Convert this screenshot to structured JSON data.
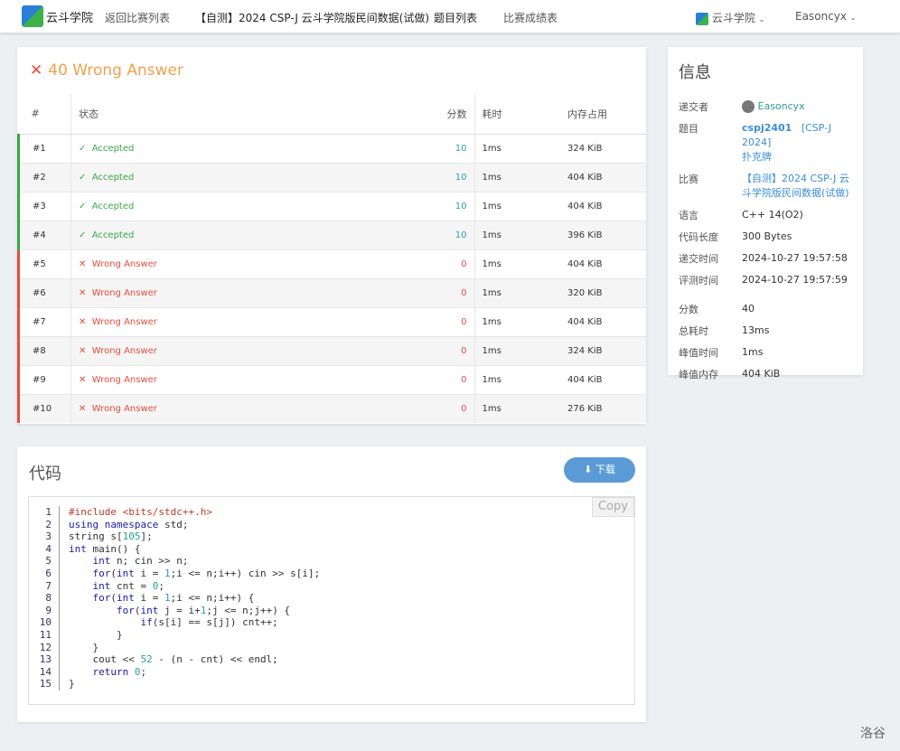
{
  "nav": {
    "logo_text": "云斗学院",
    "back": "返回比赛列表",
    "contest": "【自测】2024 CSP-J 云斗学院版民间数据(试做)",
    "problems": "题目列表",
    "ranking": "比赛成绩表",
    "site": "云斗学院",
    "user": "Easoncyx"
  },
  "result": {
    "title": "40 Wrong Answer",
    "headers": [
      "#",
      "状态",
      "分数",
      "耗时",
      "内存占用"
    ],
    "rows": [
      [
        "#1",
        "Accepted",
        "10",
        "1ms",
        "324 KiB"
      ],
      [
        "#2",
        "Accepted",
        "10",
        "1ms",
        "404 KiB"
      ],
      [
        "#3",
        "Accepted",
        "10",
        "1ms",
        "404 KiB"
      ],
      [
        "#4",
        "Accepted",
        "10",
        "1ms",
        "396 KiB"
      ],
      [
        "#5",
        "Wrong Answer",
        "0",
        "1ms",
        "404 KiB"
      ],
      [
        "#6",
        "Wrong Answer",
        "0",
        "1ms",
        "320 KiB"
      ],
      [
        "#7",
        "Wrong Answer",
        "0",
        "1ms",
        "404 KiB"
      ],
      [
        "#8",
        "Wrong Answer",
        "0",
        "1ms",
        "324 KiB"
      ],
      [
        "#9",
        "Wrong Answer",
        "0",
        "1ms",
        "404 KiB"
      ],
      [
        "#10",
        "Wrong Answer",
        "0",
        "1ms",
        "276 KiB"
      ]
    ]
  },
  "colors": {
    "accepted": "#3aa845",
    "wrong": "#e74c3c",
    "link": "#3b8ed6",
    "score_ok": "#2a9db6"
  },
  "info": {
    "title": "信息",
    "submitter_label": "递交者",
    "submitter": "Easoncyx",
    "problem_label": "题目",
    "problem_id": "cspj2401",
    "problem_tag": "[CSP-J 2024]",
    "problem_name": "扑克牌",
    "contest_label": "比赛",
    "contest": "【自测】2024 CSP-J 云斗学院版民间数据(试做)",
    "lang_label": "语言",
    "lang": "C++ 14(O2)",
    "len_label": "代码长度",
    "len": "300 Bytes",
    "submit_time_label": "递交时间",
    "submit_time": "2024-10-27 19:57:58",
    "judge_time_label": "评测时间",
    "judge_time": "2024-10-27 19:57:59",
    "score_label": "分数",
    "score": "40",
    "total_time_label": "总耗时",
    "total_time": "13ms",
    "peak_time_label": "峰值时间",
    "peak_time": "1ms",
    "peak_mem_label": "峰值内存",
    "peak_mem": "404 KiB"
  },
  "code": {
    "title": "代码",
    "download": "下载",
    "copy": "Copy",
    "lines": [
      "#include <bits/stdc++.h>",
      "using namespace std;",
      "string s[105];",
      "int main() {",
      "    int n; cin >> n;",
      "    for(int i = 1;i <= n;i++) cin >> s[i];",
      "    int cnt = 0;",
      "    for(int i = 1;i <= n;i++) {",
      "        for(int j = i+1;j <= n;j++) {",
      "            if(s[i] == s[j]) cnt++;",
      "        }",
      "    }",
      "    cout << 52 - (n - cnt) << endl;",
      "    return 0;",
      "}"
    ]
  },
  "footer": "洛谷"
}
